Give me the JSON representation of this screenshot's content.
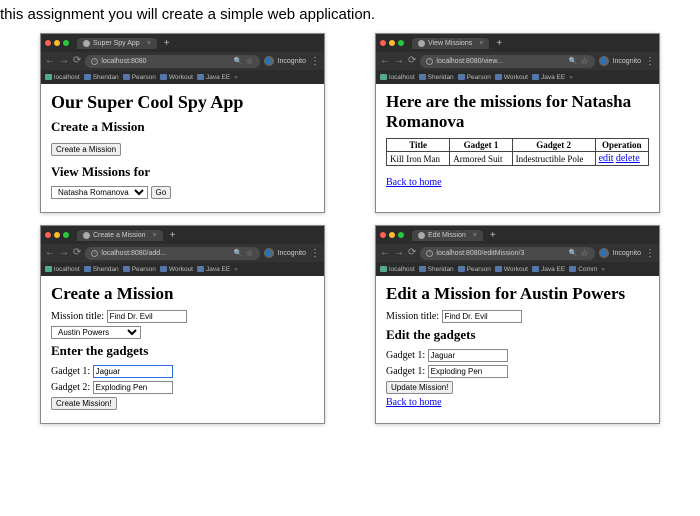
{
  "intro": "this assignment you will create a simple web application.",
  "incognito_label": "Incognito",
  "bookmarks": [
    {
      "label": "localhost",
      "icon": "t"
    },
    {
      "label": "Sheridan",
      "icon": "b"
    },
    {
      "label": "Pearson",
      "icon": "b"
    },
    {
      "label": "Workout",
      "icon": "b"
    },
    {
      "label": "Java EE",
      "icon": "b"
    }
  ],
  "bookmarks_ext": [
    {
      "label": "localhost",
      "icon": "t"
    },
    {
      "label": "Sheridan",
      "icon": "b"
    },
    {
      "label": "Pearson",
      "icon": "b"
    },
    {
      "label": "Workout",
      "icon": "b"
    },
    {
      "label": "Java EE",
      "icon": "b"
    },
    {
      "label": "Comm",
      "icon": "b"
    }
  ],
  "windows": {
    "home": {
      "tab_title": "Super Spy App",
      "url": "localhost:8080",
      "h1": "Our Super Cool Spy App",
      "create_heading": "Create a Mission",
      "create_btn": "Create a Mission",
      "view_heading": "View Missions for",
      "agent_selected": "Natasha Romanova",
      "go_btn": "Go"
    },
    "view": {
      "tab_title": "View Missions",
      "url": "localhost:8080/view...",
      "h1": "Here are the missions for Natasha Romanova",
      "cols": [
        "Title",
        "Gadget 1",
        "Gadget 2",
        "Operation"
      ],
      "rows": [
        {
          "title": "Kill Iron Man",
          "g1": "Armored Suit",
          "g2": "Indestructible Pole",
          "edit": "edit",
          "del": "delete"
        }
      ],
      "back": "Back to home"
    },
    "create": {
      "tab_title": "Create a Mission",
      "url": "localhost:8080/add...",
      "h1": "Create a Mission",
      "title_label": "Mission title:",
      "title_value": "Find Dr. Evil",
      "agent_selected": "Austin Powers",
      "gadgets_heading": "Enter the gadgets",
      "g1_label": "Gadget 1:",
      "g1_value": "Jaguar",
      "g2_label": "Gadget 2:",
      "g2_value": "Exploding Pen",
      "submit": "Create Mission!"
    },
    "edit": {
      "tab_title": "Edit Mission",
      "url": "localhost:8080/editMission/3",
      "h1": "Edit a Mission for Austin Powers",
      "title_label": "Mission title:",
      "title_value": "Find Dr. Evil",
      "gadgets_heading": "Edit the gadgets",
      "g1_label": "Gadget 1:",
      "g1_value": "Jaguar",
      "g2_label": "Gadget 1:",
      "g2_value": "Exploding Pen",
      "submit": "Update Mission!",
      "back": "Back to home"
    }
  }
}
